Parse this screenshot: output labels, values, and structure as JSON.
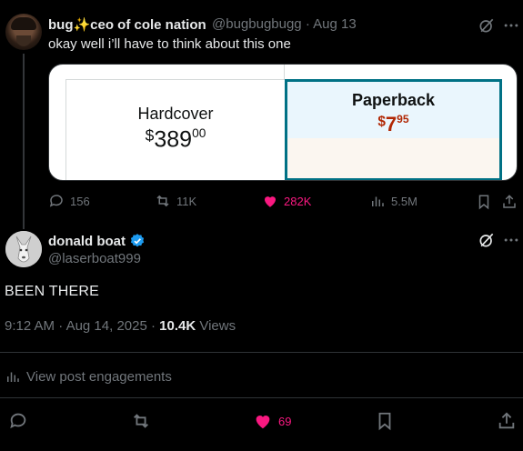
{
  "parent": {
    "name": "bug✨ceo of cole nation",
    "handle": "@bugbugbugg",
    "date": "Aug 13",
    "text": "okay well i’ll have to think about this one",
    "media": {
      "hardcover_label": "Hardcover",
      "hardcover_currency": "$",
      "hardcover_whole": "389",
      "hardcover_fraction": "00",
      "paperback_label": "Paperback",
      "paperback_currency": "$",
      "paperback_whole": "7",
      "paperback_fraction": "95"
    },
    "stats": {
      "replies": "156",
      "reposts": "11K",
      "likes": "282K",
      "views": "5.5M"
    }
  },
  "post": {
    "name": "donald boat",
    "handle": "@laserboat999",
    "text": "BEEN THERE",
    "time": "9:12 AM",
    "date": "Aug 14, 2025",
    "views_count": "10.4K",
    "views_label": "Views",
    "engagements_label": "View post engagements",
    "likes": "69"
  },
  "colors": {
    "like": "#f91880",
    "verified": "#1d9bf0",
    "muted": "#71767b"
  }
}
